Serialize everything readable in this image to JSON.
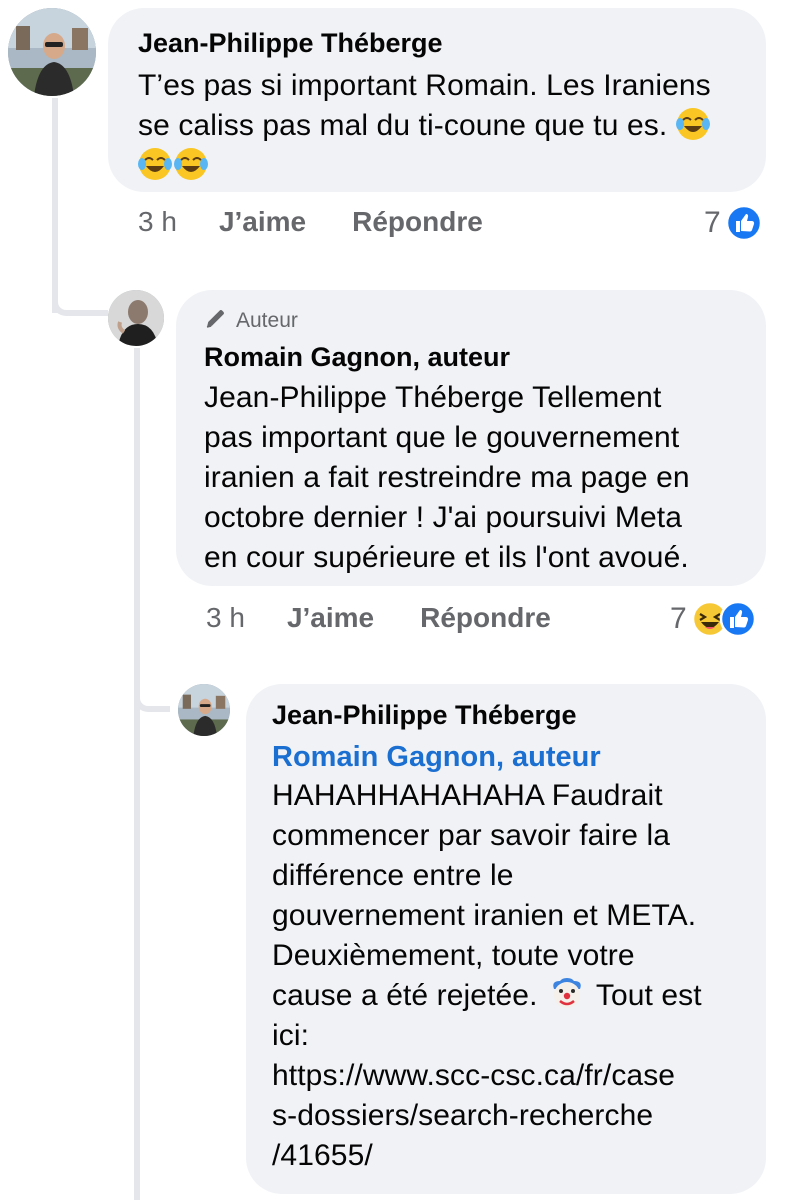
{
  "comments": [
    {
      "author": "Jean-Philippe Théberge",
      "text": "T’es pas si important Romain. Les Iraniens se caliss pas mal du ti-coune que tu es.",
      "emoji": [
        "face-with-tears-of-joy-icon",
        "face-with-tears-of-joy-icon",
        "face-with-tears-of-joy-icon"
      ],
      "time": "3 h",
      "like_label": "J’aime",
      "reply_label": "Répondre",
      "reaction_count": "7",
      "reactions": [
        "like-reaction-icon"
      ]
    },
    {
      "badge": "Auteur",
      "author": "Romain Gagnon, auteur",
      "text_lines": [
        "Jean-Philippe Théberge Tellement",
        "pas important que le gouvernement",
        "iranien a fait restreindre ma page en",
        "octobre dernier ! J'ai poursuivi Meta",
        "en cour supérieure et ils l'ont avoué."
      ],
      "time": "3 h",
      "like_label": "J’aime",
      "reply_label": "Répondre",
      "reaction_count": "7",
      "reactions": [
        "haha-reaction-icon",
        "like-reaction-icon"
      ]
    },
    {
      "author": "Jean-Philippe Théberge",
      "mention": "Romain Gagnon, auteur",
      "text_lines": [
        "HAHAHHAHAHAHA Faudrait",
        "commencer par savoir faire la",
        "différence entre le",
        "gouvernement iranien et META.",
        "Deuxièmement, toute votre"
      ],
      "text_clown_before": "cause a été rejetée.",
      "text_clown_after": "Tout est",
      "text_after_lines": [
        "ici:",
        "https://www.scc-csc.ca/fr/case",
        "s-dossiers/search-recherche",
        "/41655/"
      ],
      "emoji_inline": "clown-face-icon"
    }
  ],
  "colors": {
    "bubble": "#f0f2f5",
    "meta_text": "#65676b",
    "mention": "#1b6fd1",
    "like_blue": "#1877f2",
    "haha_yellow": "#f7c836",
    "thread_line": "#e4e6eb"
  }
}
